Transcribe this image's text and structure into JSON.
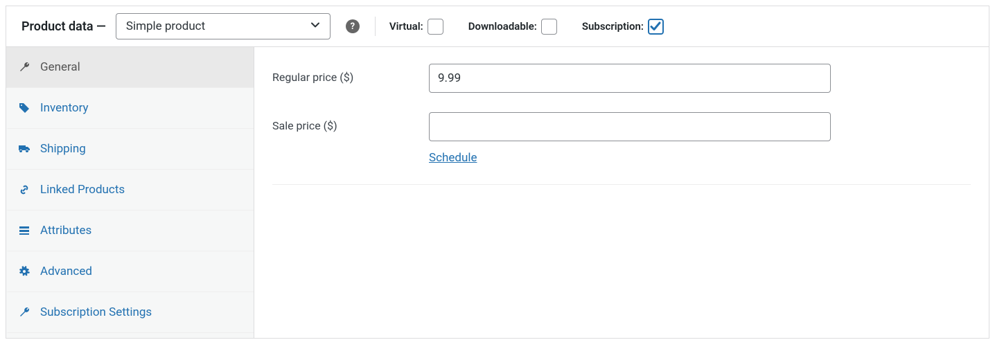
{
  "header": {
    "title": "Product data —",
    "product_type_value": "Simple product",
    "checkboxes": {
      "virtual": {
        "label": "Virtual:",
        "checked": false
      },
      "downloadable": {
        "label": "Downloadable:",
        "checked": false
      },
      "subscription": {
        "label": "Subscription:",
        "checked": true
      }
    }
  },
  "tabs": [
    {
      "key": "general",
      "label": "General",
      "icon": "wrench",
      "active": true
    },
    {
      "key": "inventory",
      "label": "Inventory",
      "icon": "tag",
      "active": false
    },
    {
      "key": "shipping",
      "label": "Shipping",
      "icon": "truck",
      "active": false
    },
    {
      "key": "linked",
      "label": "Linked Products",
      "icon": "link",
      "active": false
    },
    {
      "key": "attributes",
      "label": "Attributes",
      "icon": "list",
      "active": false
    },
    {
      "key": "advanced",
      "label": "Advanced",
      "icon": "gear",
      "active": false
    },
    {
      "key": "subscription_settings",
      "label": "Subscription Settings",
      "icon": "wrench",
      "active": false
    }
  ],
  "form": {
    "regular_price": {
      "label": "Regular price ($)",
      "value": "9.99"
    },
    "sale_price": {
      "label": "Sale price ($)",
      "value": "",
      "schedule_link": "Schedule"
    }
  },
  "icons": {
    "wrench": "🔧",
    "tag": "🏷",
    "truck": "🚚",
    "link": "🔗",
    "list": "▤",
    "gear": "⚙"
  }
}
